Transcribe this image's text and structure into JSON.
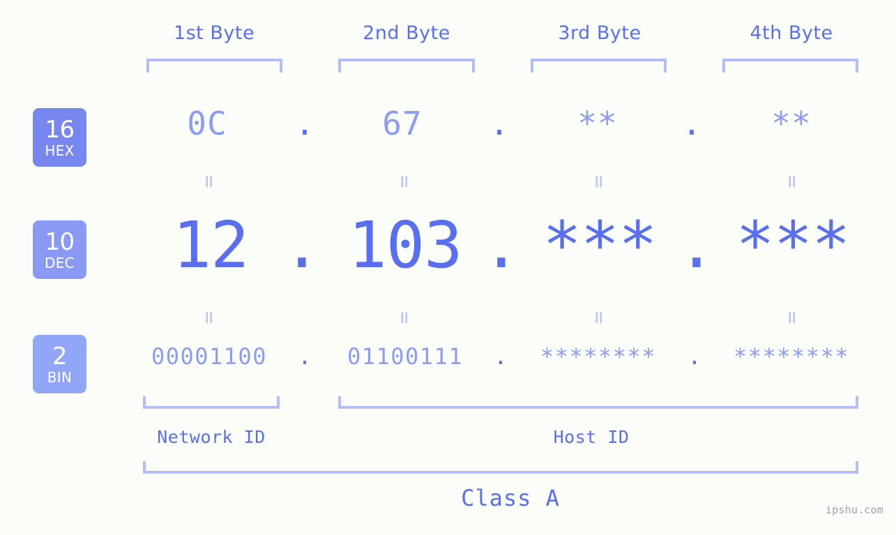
{
  "watermark": "ipshu.com",
  "colors": {
    "background": "#fbfdf9",
    "accent": "#5a6ef0",
    "accent_light": "#8c9cf5",
    "bracket": "#b3bdfa",
    "badge_hex": "#7787ef",
    "badge_dec": "#8a99f4",
    "badge_bin": "#92a6f8"
  },
  "byte_headers": [
    {
      "label": "1st Byte"
    },
    {
      "label": "2nd Byte"
    },
    {
      "label": "3rd Byte"
    },
    {
      "label": "4th Byte"
    }
  ],
  "bases": [
    {
      "num": "16",
      "label": "HEX"
    },
    {
      "num": "10",
      "label": "DEC"
    },
    {
      "num": "2",
      "label": "BIN"
    }
  ],
  "rows": {
    "hex": {
      "base_num": "16",
      "base_label": "HEX",
      "values": [
        "0C",
        "67",
        "**",
        "**"
      ],
      "separators": [
        ".",
        ".",
        "."
      ]
    },
    "dec": {
      "base_num": "10",
      "base_label": "DEC",
      "values": [
        "12",
        "103",
        "***",
        "***"
      ],
      "separators": [
        ".",
        ".",
        "."
      ]
    },
    "bin": {
      "base_num": "2",
      "base_label": "BIN",
      "values": [
        "00001100",
        "01100111",
        "********",
        "********"
      ],
      "separators": [
        ".",
        ".",
        "."
      ]
    }
  },
  "equals_marker": "=",
  "segments": {
    "network_id": "Network ID",
    "host_id": "Host ID",
    "class": "Class A"
  },
  "ip_address": {
    "hex": "0C.67.**.**",
    "dec": "12.103.***.***",
    "bin": "00001100.01100111.********.********"
  }
}
